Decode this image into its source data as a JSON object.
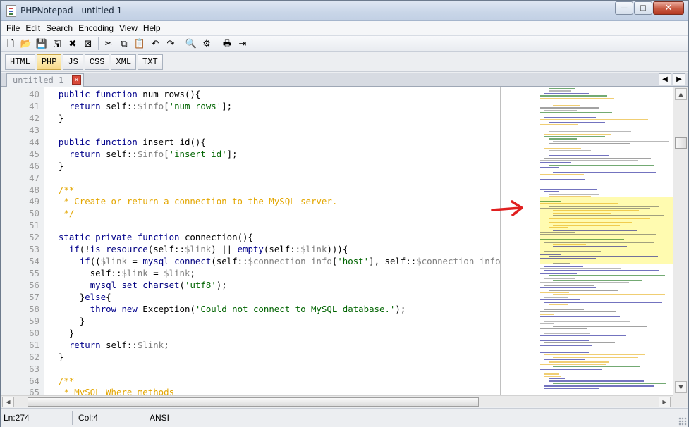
{
  "window": {
    "title": "PHPNotepad - untitled 1",
    "buttons": {
      "minimize": "—",
      "maximize": "□",
      "close": "✕"
    }
  },
  "menu": [
    "File",
    "Edit",
    "Search",
    "Encoding",
    "View",
    "Help"
  ],
  "toolbar": [
    {
      "name": "new-file-icon",
      "glyph": "🗋"
    },
    {
      "name": "open-file-icon",
      "glyph": "📂"
    },
    {
      "name": "save-icon",
      "glyph": "💾"
    },
    {
      "name": "save-all-icon",
      "glyph": "🖫"
    },
    {
      "name": "close-file-icon",
      "glyph": "✖"
    },
    {
      "name": "close-all-icon",
      "glyph": "⊠"
    },
    {
      "sep": true
    },
    {
      "name": "cut-icon",
      "glyph": "✂"
    },
    {
      "name": "copy-icon",
      "glyph": "⧉"
    },
    {
      "name": "paste-icon",
      "glyph": "📋"
    },
    {
      "name": "undo-icon",
      "glyph": "↶"
    },
    {
      "name": "redo-icon",
      "glyph": "↷"
    },
    {
      "sep": true
    },
    {
      "name": "find-icon",
      "glyph": "🔍"
    },
    {
      "name": "replace-icon",
      "glyph": "⚙"
    },
    {
      "sep": true
    },
    {
      "name": "print-icon",
      "glyph": "🖶"
    },
    {
      "name": "exit-icon",
      "glyph": "⇥"
    }
  ],
  "languages": [
    {
      "label": "HTML",
      "active": false
    },
    {
      "label": "PHP",
      "active": true
    },
    {
      "label": "JS",
      "active": false
    },
    {
      "label": "CSS",
      "active": false
    },
    {
      "label": "XML",
      "active": false
    },
    {
      "label": "TXT",
      "active": false
    }
  ],
  "document_tab": {
    "label": "untitled 1",
    "close": "✕"
  },
  "nav": {
    "prev": "◀",
    "next": "▶"
  },
  "colors": {
    "keyword": "#00008b",
    "variable": "#7f7f7f",
    "string": "#006400",
    "comment": "#e3a600",
    "function": "#000080",
    "plain": "#000000"
  },
  "code": [
    {
      "n": "40",
      "t": [
        [
          "plain",
          "  "
        ],
        [
          "keyword",
          "public function "
        ],
        [
          "plain",
          "num_rows(){"
        ]
      ]
    },
    {
      "n": "41",
      "t": [
        [
          "plain",
          "    "
        ],
        [
          "keyword",
          "return "
        ],
        [
          "plain",
          "self::"
        ],
        [
          "variable",
          "$info"
        ],
        [
          "plain",
          "["
        ],
        [
          "string",
          "'num_rows'"
        ],
        [
          "plain",
          "];"
        ]
      ]
    },
    {
      "n": "42",
      "t": [
        [
          "plain",
          "  }"
        ]
      ]
    },
    {
      "n": "43",
      "t": []
    },
    {
      "n": "44",
      "t": [
        [
          "plain",
          "  "
        ],
        [
          "keyword",
          "public function "
        ],
        [
          "plain",
          "insert_id(){"
        ]
      ]
    },
    {
      "n": "45",
      "t": [
        [
          "plain",
          "    "
        ],
        [
          "keyword",
          "return "
        ],
        [
          "plain",
          "self::"
        ],
        [
          "variable",
          "$info"
        ],
        [
          "plain",
          "["
        ],
        [
          "string",
          "'insert_id'"
        ],
        [
          "plain",
          "];"
        ]
      ]
    },
    {
      "n": "46",
      "t": [
        [
          "plain",
          "  }"
        ]
      ]
    },
    {
      "n": "47",
      "t": []
    },
    {
      "n": "48",
      "t": [
        [
          "comment",
          "  /**"
        ]
      ]
    },
    {
      "n": "49",
      "t": [
        [
          "comment",
          "   * Create or return a connection to the MySQL server."
        ]
      ]
    },
    {
      "n": "50",
      "t": [
        [
          "comment",
          "   */"
        ]
      ]
    },
    {
      "n": "51",
      "t": []
    },
    {
      "n": "52",
      "t": [
        [
          "plain",
          "  "
        ],
        [
          "keyword",
          "static private function "
        ],
        [
          "plain",
          "connection(){"
        ]
      ]
    },
    {
      "n": "53",
      "t": [
        [
          "plain",
          "    "
        ],
        [
          "keyword",
          "if"
        ],
        [
          "plain",
          "(!"
        ],
        [
          "function",
          "is_resource"
        ],
        [
          "plain",
          "(self::"
        ],
        [
          "variable",
          "$link"
        ],
        [
          "plain",
          ") || "
        ],
        [
          "keyword",
          "empty"
        ],
        [
          "plain",
          "(self::"
        ],
        [
          "variable",
          "$link"
        ],
        [
          "plain",
          "))){"
        ]
      ]
    },
    {
      "n": "54",
      "t": [
        [
          "plain",
          "      "
        ],
        [
          "keyword",
          "if"
        ],
        [
          "plain",
          "(("
        ],
        [
          "variable",
          "$link"
        ],
        [
          "plain",
          " = "
        ],
        [
          "function",
          "mysql_connect"
        ],
        [
          "plain",
          "(self::"
        ],
        [
          "variable",
          "$connection_info"
        ],
        [
          "plain",
          "["
        ],
        [
          "string",
          "'host'"
        ],
        [
          "plain",
          "], self::"
        ],
        [
          "variable",
          "$connection_info"
        ]
      ]
    },
    {
      "n": "55",
      "t": [
        [
          "plain",
          "        self::"
        ],
        [
          "variable",
          "$link"
        ],
        [
          "plain",
          " = "
        ],
        [
          "variable",
          "$link"
        ],
        [
          "plain",
          ";"
        ]
      ]
    },
    {
      "n": "56",
      "t": [
        [
          "plain",
          "        "
        ],
        [
          "function",
          "mysql_set_charset"
        ],
        [
          "plain",
          "("
        ],
        [
          "string",
          "'utf8'"
        ],
        [
          "plain",
          ");"
        ]
      ]
    },
    {
      "n": "57",
      "t": [
        [
          "plain",
          "      }"
        ],
        [
          "keyword",
          "else"
        ],
        [
          "plain",
          "{"
        ]
      ]
    },
    {
      "n": "58",
      "t": [
        [
          "plain",
          "        "
        ],
        [
          "keyword",
          "throw new "
        ],
        [
          "plain",
          "Exception("
        ],
        [
          "string",
          "'Could not connect to MySQL database.'"
        ],
        [
          "plain",
          ");"
        ]
      ]
    },
    {
      "n": "59",
      "t": [
        [
          "plain",
          "      }"
        ]
      ]
    },
    {
      "n": "60",
      "t": [
        [
          "plain",
          "    }"
        ]
      ]
    },
    {
      "n": "61",
      "t": [
        [
          "plain",
          "    "
        ],
        [
          "keyword",
          "return "
        ],
        [
          "plain",
          "self::"
        ],
        [
          "variable",
          "$link"
        ],
        [
          "plain",
          ";"
        ]
      ]
    },
    {
      "n": "62",
      "t": [
        [
          "plain",
          "  }"
        ]
      ]
    },
    {
      "n": "63",
      "t": []
    },
    {
      "n": "64",
      "t": [
        [
          "comment",
          "  /**"
        ]
      ]
    },
    {
      "n": "65",
      "t": [
        [
          "comment",
          "   * MySQL Where methods"
        ]
      ]
    }
  ],
  "status": {
    "line": "Ln:274",
    "col": "Col:4",
    "encoding": "ANSI"
  },
  "scroll": {
    "up": "▲",
    "down": "▼",
    "left": "◀",
    "right": "▶"
  }
}
